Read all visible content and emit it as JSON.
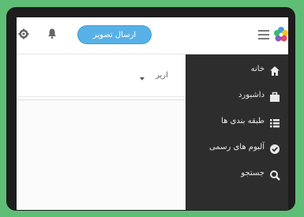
{
  "topbar": {
    "upload_button_label": "ارسال تصویر",
    "icons": [
      "gear-icon",
      "bell-icon",
      "hamburger-menu-icon",
      "pinwheel-logo"
    ]
  },
  "filter": {
    "label_partial": "اریر"
  },
  "drawer": {
    "items": [
      {
        "label": "خانه",
        "icon": "home-icon"
      },
      {
        "label": "داشبورد",
        "icon": "dashboard-icon"
      },
      {
        "label": "طبقه بندی ها",
        "icon": "list-icon"
      },
      {
        "label": "آلبوم های رسمی",
        "icon": "check-circle-icon"
      },
      {
        "label": "جستجو",
        "icon": "search-icon"
      }
    ]
  },
  "colors": {
    "background": "#5fbe75",
    "frame": "#1d1d1d",
    "accent": "#58b1e6",
    "drawer": "#2d2d2d"
  }
}
